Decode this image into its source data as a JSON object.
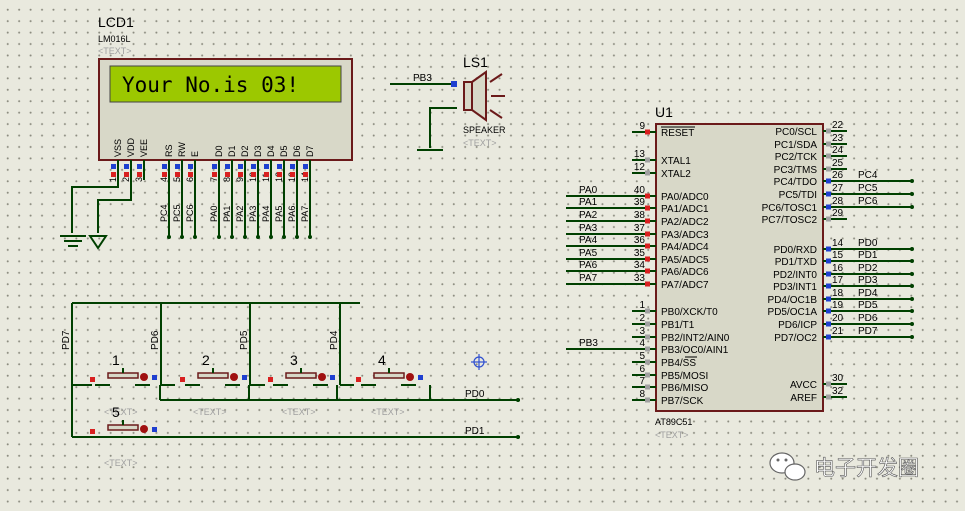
{
  "lcd": {
    "ref": "LCD1",
    "part": "LM016L",
    "text_tag": "<TEXT>",
    "display": "Your No.is 03!",
    "pin_names": [
      "VSS",
      "VDD",
      "VEE",
      "RS",
      "RW",
      "E",
      "D0",
      "D1",
      "D2",
      "D3",
      "D4",
      "D5",
      "D6",
      "D7"
    ],
    "pin_numbers": [
      "1",
      "2",
      "3",
      "4",
      "5",
      "6",
      "7",
      "8",
      "9",
      "10",
      "11",
      "12",
      "13",
      "14"
    ],
    "net_labels": [
      "PC4",
      "PC5",
      "PC6",
      "PA0",
      "PA1",
      "PA2",
      "PA3",
      "PA4",
      "PA5",
      "PA6",
      "PA7"
    ]
  },
  "speaker": {
    "ref": "LS1",
    "part": "SPEAKER",
    "text_tag": "<TEXT>",
    "net": "PB3"
  },
  "mcu": {
    "ref": "U1",
    "part": "AT89C51",
    "text_tag": "<TEXT>",
    "left_pins": [
      {
        "num": "9",
        "name": "RESET"
      },
      {
        "num": "13",
        "name": "XTAL1"
      },
      {
        "num": "12",
        "name": "XTAL2"
      },
      {
        "num": "40",
        "name": "PA0/ADC0"
      },
      {
        "num": "39",
        "name": "PA1/ADC1"
      },
      {
        "num": "38",
        "name": "PA2/ADC2"
      },
      {
        "num": "37",
        "name": "PA3/ADC3"
      },
      {
        "num": "36",
        "name": "PA4/ADC4"
      },
      {
        "num": "35",
        "name": "PA5/ADC5"
      },
      {
        "num": "34",
        "name": "PA6/ADC6"
      },
      {
        "num": "33",
        "name": "PA7/ADC7"
      },
      {
        "num": "1",
        "name": "PB0/XCK/T0"
      },
      {
        "num": "2",
        "name": "PB1/T1"
      },
      {
        "num": "3",
        "name": "PB2/INT2/AIN0"
      },
      {
        "num": "4",
        "name": "PB3/OC0/AIN1"
      },
      {
        "num": "5",
        "name": "PB4/SS"
      },
      {
        "num": "6",
        "name": "PB5/MOSI"
      },
      {
        "num": "7",
        "name": "PB6/MISO"
      },
      {
        "num": "8",
        "name": "PB7/SCK"
      }
    ],
    "right_pins": [
      {
        "num": "22",
        "name": "PC0/SCL"
      },
      {
        "num": "23",
        "name": "PC1/SDA"
      },
      {
        "num": "24",
        "name": "PC2/TCK"
      },
      {
        "num": "25",
        "name": "PC3/TMS"
      },
      {
        "num": "26",
        "name": "PC4/TDO"
      },
      {
        "num": "27",
        "name": "PC5/TDI"
      },
      {
        "num": "28",
        "name": "PC6/TOSC1"
      },
      {
        "num": "29",
        "name": "PC7/TOSC2"
      },
      {
        "num": "14",
        "name": "PD0/RXD"
      },
      {
        "num": "15",
        "name": "PD1/TXD"
      },
      {
        "num": "16",
        "name": "PD2/INT0"
      },
      {
        "num": "17",
        "name": "PD3/INT1"
      },
      {
        "num": "18",
        "name": "PD4/OC1B"
      },
      {
        "num": "19",
        "name": "PD5/OC1A"
      },
      {
        "num": "20",
        "name": "PD6/ICP"
      },
      {
        "num": "21",
        "name": "PD7/OC2"
      },
      {
        "num": "30",
        "name": "AVCC"
      },
      {
        "num": "32",
        "name": "AREF"
      }
    ],
    "left_nets": [
      "PA0",
      "PA1",
      "PA2",
      "PA3",
      "PA4",
      "PA5",
      "PA6",
      "PA7",
      "PB3"
    ],
    "right_nets": [
      "PC4",
      "PC5",
      "PC6",
      "PD0",
      "PD1",
      "PD2",
      "PD3",
      "PD4",
      "PD5",
      "PD6",
      "PD7"
    ]
  },
  "buttons": {
    "refs": [
      "1",
      "2",
      "3",
      "4",
      "5"
    ],
    "text_tag": "<TEXT>",
    "column_nets": [
      "PD7",
      "PD6",
      "PD5",
      "PD4"
    ],
    "row_nets": [
      "PD0",
      "PD1"
    ]
  },
  "watermark": "电子开发圈"
}
